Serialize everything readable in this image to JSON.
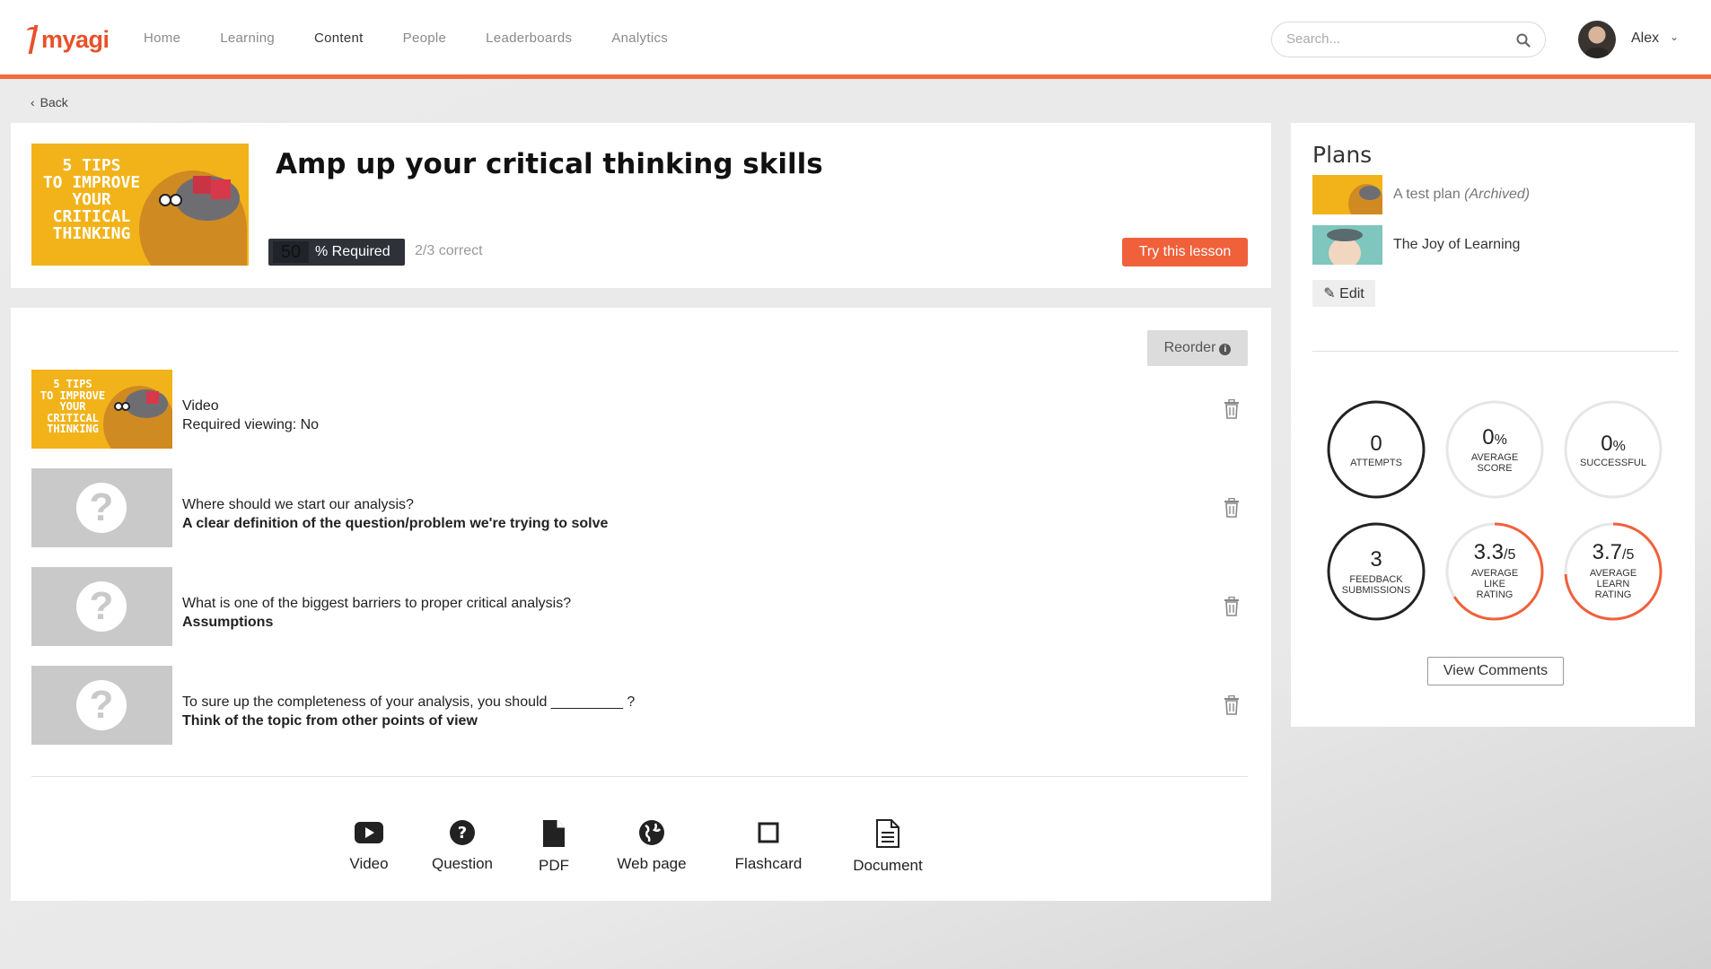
{
  "brand": {
    "name": "myagi",
    "color": "#e8502a"
  },
  "nav": {
    "items": [
      {
        "label": "Home",
        "active": false
      },
      {
        "label": "Learning",
        "active": false
      },
      {
        "label": "Content",
        "active": true
      },
      {
        "label": "People",
        "active": false
      },
      {
        "label": "Leaderboards",
        "active": false
      },
      {
        "label": "Analytics",
        "active": false
      }
    ]
  },
  "search": {
    "placeholder": "Search...",
    "value": "",
    "icon": "search-icon"
  },
  "user": {
    "name": "Alex"
  },
  "back": {
    "label": "Back"
  },
  "lesson": {
    "title": "Amp up your critical thinking skills",
    "thumbnail_text": [
      "5 TIPS",
      "TO IMPROVE",
      "YOUR",
      "CRITICAL",
      "THINKING"
    ],
    "required_value": "50",
    "required_label": "% Required",
    "correct": "2/3 correct",
    "try_label": "Try this lesson"
  },
  "content": {
    "reorder_label": "Reorder",
    "items": [
      {
        "type": "video",
        "line1": "Video",
        "line2": "Required viewing: No"
      },
      {
        "type": "question",
        "line1": "Where should we start our analysis?",
        "line2": "A clear definition of the question/problem we're trying to solve"
      },
      {
        "type": "question",
        "line1": "What is one of the biggest barriers to proper critical analysis?",
        "line2": "Assumptions"
      },
      {
        "type": "question",
        "line1": "To sure up the completeness of your analysis, you should _________ ?",
        "line2": "Think of the topic from other points of view"
      }
    ],
    "add_tools": [
      {
        "label": "Video",
        "icon": "video-play-icon"
      },
      {
        "label": "Question",
        "icon": "question-circle-icon"
      },
      {
        "label": "PDF",
        "icon": "file-icon"
      },
      {
        "label": "Web page",
        "icon": "globe-icon"
      },
      {
        "label": "Flashcard",
        "icon": "square-icon"
      },
      {
        "label": "Document",
        "icon": "document-icon"
      }
    ]
  },
  "plans": {
    "title": "Plans",
    "items": [
      {
        "name": "A test plan",
        "tag": "(Archived)"
      },
      {
        "name": "The Joy of Learning",
        "tag": ""
      }
    ],
    "edit_label": "Edit"
  },
  "stats": [
    {
      "value": "0",
      "suffix": "",
      "label": [
        "ATTEMPTS"
      ],
      "progress": 0
    },
    {
      "value": "0",
      "suffix": "%",
      "label": [
        "AVERAGE",
        "SCORE"
      ],
      "progress": 0
    },
    {
      "value": "0",
      "suffix": "%",
      "label": [
        "SUCCESSFUL"
      ],
      "progress": 0
    },
    {
      "value": "3",
      "suffix": "",
      "label": [
        "FEEDBACK",
        "SUBMISSIONS"
      ],
      "progress": 0
    },
    {
      "value": "3.3",
      "suffix": "/5",
      "label": [
        "AVERAGE",
        "LIKE",
        "RATING"
      ],
      "progress": 0.66
    },
    {
      "value": "3.7",
      "suffix": "/5",
      "label": [
        "AVERAGE",
        "LEARN",
        "RATING"
      ],
      "progress": 0.74
    }
  ],
  "view_comments_label": "View Comments",
  "colors": {
    "accent": "#f0603b",
    "dark": "#2e3238",
    "ring_dark": "#222222",
    "ring_light": "#e6e6e6"
  }
}
